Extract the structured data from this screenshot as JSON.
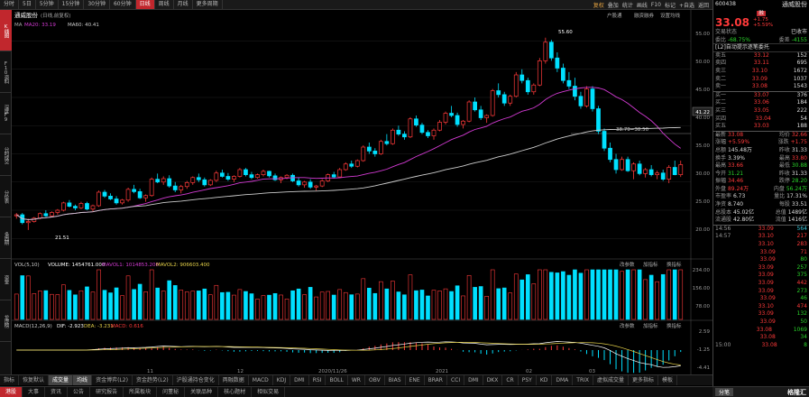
{
  "periods": [
    "分时",
    "5日",
    "5分钟",
    "15分钟",
    "30分钟",
    "60分钟",
    "日线",
    "周线",
    "月线",
    "更多周期"
  ],
  "active_period": "日线",
  "toolbar_right": [
    "复权",
    "叠加",
    "统计",
    "画线",
    "F10",
    "标记",
    "+自选",
    "返回"
  ],
  "left_tabs": [
    "K线图",
    "F10资料",
    "深度F9",
    "分时成交",
    "分价表",
    "多周期",
    "资金",
    "龙虎榜"
  ],
  "chart_title": "通威股份",
  "chart_subtitle": "(日线,前复权)",
  "ma_legend": {
    "ma": "MA",
    "ma20": "MA20: 33.19",
    "ma60": "MA60: 40.41"
  },
  "tr_links": [
    "户股通",
    "融资融券",
    "设置均线"
  ],
  "price_axis": [
    "55.00",
    "50.00",
    "45.00",
    "40.00",
    "35.00",
    "30.00",
    "25.00",
    "20.00"
  ],
  "current_price_box": "41.22",
  "annotations": {
    "high": "55.60",
    "low": "21.51",
    "mid": "38.79=38.50"
  },
  "vol_legend": {
    "label": "VOL(5,10)",
    "volume": "VOLUME: 1454761.000",
    "mavol1": "MAVOL1: 1014853.200",
    "mavol2": "MAVOL2: 906603.400"
  },
  "vol_axis": [
    "234.00",
    "156.00",
    "78.00"
  ],
  "macd_legend": {
    "label": "MACD(12,26,9)",
    "dif": "DIF: -2.923",
    "dea": "DEA: -3.231",
    "macd": "MACD: 0.616"
  },
  "macd_axis": [
    "2.59",
    "-1.25",
    "-4.41"
  ],
  "panel_links": [
    "改参数",
    "加指标",
    "换指标"
  ],
  "date_labels": [
    "2020/11/26",
    "2021",
    "02",
    "03",
    "11",
    "12"
  ],
  "bottom_tabs": [
    "指标",
    "恢复默认",
    "成交量",
    "均线",
    "资金博弈(L2)",
    "资金趋势(L2)",
    "沪股通持仓变化",
    "两融数据",
    "MACD",
    "KDJ",
    "DMI",
    "RSI",
    "BOLL",
    "WR",
    "OBV",
    "BIAS",
    "ENE",
    "BRAR",
    "CCI",
    "DMI",
    "DKX",
    "CR",
    "PSY",
    "KD",
    "DMA",
    "TRIX",
    "虚拟成交量",
    "更多指标",
    "模板"
  ],
  "status_tabs": [
    "港股",
    "大事",
    "资讯",
    "公告",
    "研究报告",
    "所属板块",
    "问董秘",
    "关联品种",
    "核心题材",
    "相似交易"
  ],
  "stock": {
    "code": "600438",
    "name": "通威股份",
    "badge": "融",
    "price": "33.08",
    "change": "+1.75",
    "change_pct": "+5.59%",
    "trade_status_label": "交易状态",
    "trade_status": "已收市",
    "weibi_label": "委比",
    "weibi": "-68.75%",
    "weicha_label": "委差",
    "weicha": "-4155",
    "notice": "[L2]自动提示逐笔委托"
  },
  "asks": [
    {
      "l": "卖五",
      "p": "33.12",
      "v": "152"
    },
    {
      "l": "卖四",
      "p": "33.11",
      "v": "695"
    },
    {
      "l": "卖三",
      "p": "33.10",
      "v": "1672"
    },
    {
      "l": "卖二",
      "p": "33.09",
      "v": "1037"
    },
    {
      "l": "卖一",
      "p": "33.08",
      "v": "1543"
    }
  ],
  "bids": [
    {
      "l": "买一",
      "p": "33.07",
      "v": "376"
    },
    {
      "l": "买二",
      "p": "33.06",
      "v": "184"
    },
    {
      "l": "买三",
      "p": "33.05",
      "v": "222"
    },
    {
      "l": "买四",
      "p": "33.04",
      "v": "54"
    },
    {
      "l": "买五",
      "p": "33.03",
      "v": "188"
    }
  ],
  "stats": [
    {
      "a": "最新",
      "av": "33.08",
      "b": "均价",
      "bv": "32.66",
      "ac": "red",
      "bc": "red"
    },
    {
      "a": "涨幅",
      "av": "+5.59%",
      "b": "涨跌",
      "bv": "+1.75",
      "ac": "red",
      "bc": "red"
    },
    {
      "a": "总额",
      "av": "145.48万",
      "b": "昨收",
      "bv": "31.33",
      "ac": "wht",
      "bc": "wht"
    },
    {
      "a": "换手",
      "av": "3.39%",
      "b": "最高",
      "bv": "33.80",
      "ac": "wht",
      "bc": "red"
    },
    {
      "a": "最高",
      "av": "33.66",
      "b": "最低",
      "bv": "30.88",
      "ac": "red",
      "bc": "grn"
    },
    {
      "a": "今开",
      "av": "31.21",
      "b": "昨收",
      "bv": "31.33",
      "ac": "grn",
      "bc": "wht"
    },
    {
      "a": "振幅",
      "av": "34.46",
      "b": "跌停",
      "bv": "28.20",
      "ac": "red",
      "bc": "grn"
    },
    {
      "a": "外盘",
      "av": "89.24万",
      "b": "内盘",
      "bv": "56.24万",
      "ac": "red",
      "bc": "grn"
    },
    {
      "a": "市盈率",
      "av": "6.73",
      "b": "量比",
      "bv": "17.31%",
      "ac": "wht",
      "bc": "wht"
    },
    {
      "a": "净资",
      "av": "8.740",
      "b": "每股",
      "bv": "33.51",
      "ac": "wht",
      "bc": "wht"
    },
    {
      "a": "总股本",
      "av": "45.02亿",
      "b": "总值",
      "bv": "1489亿",
      "ac": "wht",
      "bc": "wht"
    },
    {
      "a": "流通股",
      "av": "42.80亿",
      "b": "流值",
      "bv": "1416亿",
      "ac": "wht",
      "bc": "wht"
    }
  ],
  "ticks": [
    {
      "t": "14:56",
      "p": "33.09",
      "v": "564",
      "c": "red",
      "vc": "cyn"
    },
    {
      "t": "14:57",
      "p": "33.10",
      "v": "217",
      "c": "red",
      "vc": "red"
    },
    {
      "t": "",
      "p": "33.10",
      "v": "283",
      "c": "red",
      "vc": "red"
    },
    {
      "t": "",
      "p": "33.09",
      "v": "71",
      "c": "red",
      "vc": "red"
    },
    {
      "t": "",
      "p": "33.09",
      "v": "80",
      "c": "red",
      "vc": "grn"
    },
    {
      "t": "",
      "p": "33.09",
      "v": "257",
      "c": "red",
      "vc": "grn"
    },
    {
      "t": "",
      "p": "33.09",
      "v": "375",
      "c": "red",
      "vc": "grn"
    },
    {
      "t": "",
      "p": "33.09",
      "v": "442",
      "c": "red",
      "vc": "red"
    },
    {
      "t": "",
      "p": "33.09",
      "v": "273",
      "c": "red",
      "vc": "grn"
    },
    {
      "t": "",
      "p": "33.09",
      "v": "46",
      "c": "red",
      "vc": "grn"
    },
    {
      "t": "",
      "p": "33.10",
      "v": "474",
      "c": "red",
      "vc": "red"
    },
    {
      "t": "",
      "p": "33.09",
      "v": "132",
      "c": "red",
      "vc": "grn"
    },
    {
      "t": "",
      "p": "33.09",
      "v": "50",
      "c": "red",
      "vc": "grn"
    },
    {
      "t": "",
      "p": "33.08",
      "v": "1069",
      "c": "red",
      "vc": "grn"
    },
    {
      "t": "",
      "p": "33.08",
      "v": "34",
      "c": "red",
      "vc": "grn"
    },
    {
      "t": "15:00",
      "p": "33.08",
      "v": "8",
      "c": "red",
      "vc": "grn"
    }
  ],
  "rp_bottom_tab": "分笔",
  "watermark": "格隆汇",
  "colors": {
    "up": "#ff3a3a",
    "down": "#00e0ff",
    "ma20": "#d23ad2",
    "ma60": "#cccccc",
    "accent": "#c1272d"
  },
  "chart_data": {
    "type": "candlestick",
    "title": "通威股份",
    "ylim": [
      17,
      57
    ],
    "candles": [
      [
        24,
        24.5,
        23.5,
        24.2
      ],
      [
        24.2,
        24.5,
        22.5,
        22.8
      ],
      [
        22.8,
        23.5,
        21.5,
        23.0
      ],
      [
        23.0,
        23.8,
        22.8,
        23.6
      ],
      [
        23.6,
        24.6,
        23.4,
        24.4
      ],
      [
        24.4,
        25.0,
        23.8,
        24.0
      ],
      [
        24.0,
        24.8,
        23.8,
        24.6
      ],
      [
        24.6,
        25.2,
        24.2,
        25.0
      ],
      [
        25.0,
        26.5,
        24.8,
        26.3
      ],
      [
        26.3,
        26.8,
        25.5,
        25.7
      ],
      [
        25.7,
        26.0,
        25.0,
        25.4
      ],
      [
        25.4,
        26.5,
        25.2,
        26.2
      ],
      [
        26.2,
        26.5,
        25.0,
        25.2
      ],
      [
        25.2,
        26.0,
        24.8,
        25.8
      ],
      [
        25.8,
        28.5,
        25.6,
        28.2
      ],
      [
        28.2,
        28.6,
        27.2,
        27.5
      ],
      [
        27.5,
        28.0,
        26.8,
        27.0
      ],
      [
        27.0,
        27.5,
        26.0,
        26.3
      ],
      [
        26.3,
        27.0,
        26.0,
        26.8
      ],
      [
        26.8,
        29.0,
        26.5,
        28.7
      ],
      [
        28.7,
        29.5,
        28.0,
        28.3
      ],
      [
        28.3,
        28.8,
        27.0,
        27.2
      ],
      [
        27.2,
        27.8,
        26.5,
        27.6
      ],
      [
        27.6,
        30.8,
        27.4,
        30.5
      ],
      [
        30.5,
        31.5,
        29.8,
        30.0
      ],
      [
        30.0,
        31.0,
        29.5,
        30.6
      ],
      [
        30.6,
        31.2,
        29.0,
        29.3
      ],
      [
        29.3,
        30.0,
        28.2,
        28.6
      ],
      [
        28.6,
        29.5,
        28.0,
        29.2
      ],
      [
        29.2,
        30.2,
        28.8,
        29.9
      ],
      [
        29.9,
        31.0,
        29.5,
        30.8
      ],
      [
        30.8,
        31.5,
        30.0,
        30.4
      ],
      [
        30.4,
        30.8,
        29.2,
        29.5
      ],
      [
        29.5,
        30.5,
        29.3,
        30.3
      ],
      [
        30.3,
        32.0,
        30.0,
        31.6
      ],
      [
        31.6,
        32.2,
        30.8,
        31.0
      ],
      [
        31.0,
        31.6,
        30.2,
        30.5
      ],
      [
        30.5,
        31.2,
        30.0,
        31.0
      ],
      [
        31.0,
        32.5,
        30.8,
        32.2
      ],
      [
        32.2,
        32.5,
        31.0,
        31.3
      ],
      [
        31.3,
        31.8,
        30.5,
        30.8
      ],
      [
        30.8,
        31.5,
        30.6,
        31.3
      ],
      [
        31.3,
        32.2,
        31.0,
        31.9
      ],
      [
        31.9,
        32.0,
        30.8,
        31.1
      ],
      [
        31.1,
        31.5,
        30.2,
        30.4
      ],
      [
        30.4,
        31.0,
        29.8,
        30.8
      ],
      [
        30.8,
        31.4,
        30.5,
        31.2
      ],
      [
        31.2,
        31.5,
        30.0,
        30.2
      ],
      [
        30.2,
        30.8,
        29.2,
        29.5
      ],
      [
        29.5,
        30.2,
        29.0,
        30.0
      ],
      [
        30.0,
        30.5,
        28.8,
        29.1
      ],
      [
        29.1,
        29.5,
        28.5,
        29.3
      ],
      [
        29.3,
        30.5,
        29.1,
        30.2
      ],
      [
        30.2,
        31.5,
        30.0,
        31.3
      ],
      [
        31.3,
        31.8,
        30.6,
        30.9
      ],
      [
        30.9,
        32.5,
        30.8,
        32.2
      ],
      [
        32.2,
        33.5,
        32.0,
        33.2
      ],
      [
        33.2,
        33.8,
        32.5,
        32.8
      ],
      [
        32.8,
        34.0,
        32.6,
        33.8
      ],
      [
        33.8,
        36.5,
        33.6,
        36.2
      ],
      [
        36.2,
        37.0,
        35.0,
        35.5
      ],
      [
        35.5,
        36.0,
        34.5,
        35.0
      ],
      [
        35.0,
        37.5,
        34.8,
        37.2
      ],
      [
        37.2,
        38.5,
        36.5,
        36.8
      ],
      [
        36.8,
        39.5,
        36.6,
        39.2
      ],
      [
        39.2,
        40.0,
        38.2,
        38.5
      ],
      [
        38.5,
        39.0,
        37.5,
        38.0
      ],
      [
        38.0,
        41.5,
        37.8,
        41.2
      ],
      [
        41.2,
        41.8,
        39.8,
        40.1
      ],
      [
        40.1,
        40.5,
        38.5,
        38.8
      ],
      [
        38.8,
        39.2,
        37.8,
        38.2
      ],
      [
        38.2,
        39.5,
        37.5,
        39.2
      ],
      [
        39.2,
        41.0,
        39.0,
        40.6
      ],
      [
        40.6,
        42.5,
        40.2,
        42.2
      ],
      [
        42.2,
        43.5,
        41.5,
        41.8
      ],
      [
        41.8,
        42.3,
        39.8,
        40.2
      ],
      [
        40.2,
        41.0,
        39.5,
        40.8
      ],
      [
        40.8,
        44.5,
        40.6,
        44.2
      ],
      [
        44.2,
        45.0,
        42.5,
        42.8
      ],
      [
        42.8,
        43.5,
        41.0,
        41.4
      ],
      [
        41.4,
        42.0,
        40.5,
        41.8
      ],
      [
        41.8,
        46.5,
        41.6,
        46.2
      ],
      [
        46.2,
        47.5,
        45.0,
        45.5
      ],
      [
        45.5,
        46.0,
        43.5,
        44.0
      ],
      [
        44.0,
        45.5,
        43.5,
        45.2
      ],
      [
        45.2,
        49.5,
        45.0,
        49.0
      ],
      [
        49.0,
        50.0,
        47.5,
        48.0
      ],
      [
        48.0,
        48.5,
        45.5,
        46.0
      ],
      [
        46.0,
        47.5,
        45.5,
        47.2
      ],
      [
        47.2,
        52.0,
        47.0,
        51.5
      ],
      [
        51.5,
        55.6,
        51.0,
        54.8
      ],
      [
        54.8,
        55.2,
        51.5,
        52.0
      ],
      [
        52.0,
        53.0,
        49.5,
        50.2
      ],
      [
        50.2,
        51.0,
        47.5,
        48.0
      ],
      [
        48.0,
        49.5,
        46.5,
        47.0
      ],
      [
        47.0,
        48.5,
        44.5,
        45.2
      ],
      [
        45.2,
        46.0,
        43.0,
        43.5
      ],
      [
        43.5,
        47.0,
        43.2,
        46.5
      ],
      [
        46.5,
        47.0,
        42.5,
        43.0
      ],
      [
        43.0,
        43.5,
        38.5,
        39.0
      ],
      [
        39.0,
        39.5,
        35.5,
        36.0
      ],
      [
        36.0,
        37.0,
        33.5,
        34.0
      ],
      [
        34.0,
        35.0,
        31.5,
        32.2
      ],
      [
        32.2,
        34.5,
        32.0,
        34.0
      ],
      [
        34.0,
        34.5,
        31.8,
        32.0
      ],
      [
        32.0,
        33.5,
        30.5,
        33.2
      ],
      [
        33.2,
        33.8,
        31.2,
        31.5
      ],
      [
        31.5,
        32.5,
        30.8,
        32.2
      ],
      [
        32.2,
        33.0,
        31.0,
        31.3
      ],
      [
        31.3,
        32.0,
        30.5,
        31.6
      ],
      [
        31.6,
        32.2,
        30.2,
        30.5
      ],
      [
        30.5,
        33.0,
        29.8,
        32.6
      ],
      [
        32.6,
        33.8,
        31.2,
        31.3
      ],
      [
        31.3,
        33.8,
        30.9,
        33.08
      ]
    ]
  }
}
